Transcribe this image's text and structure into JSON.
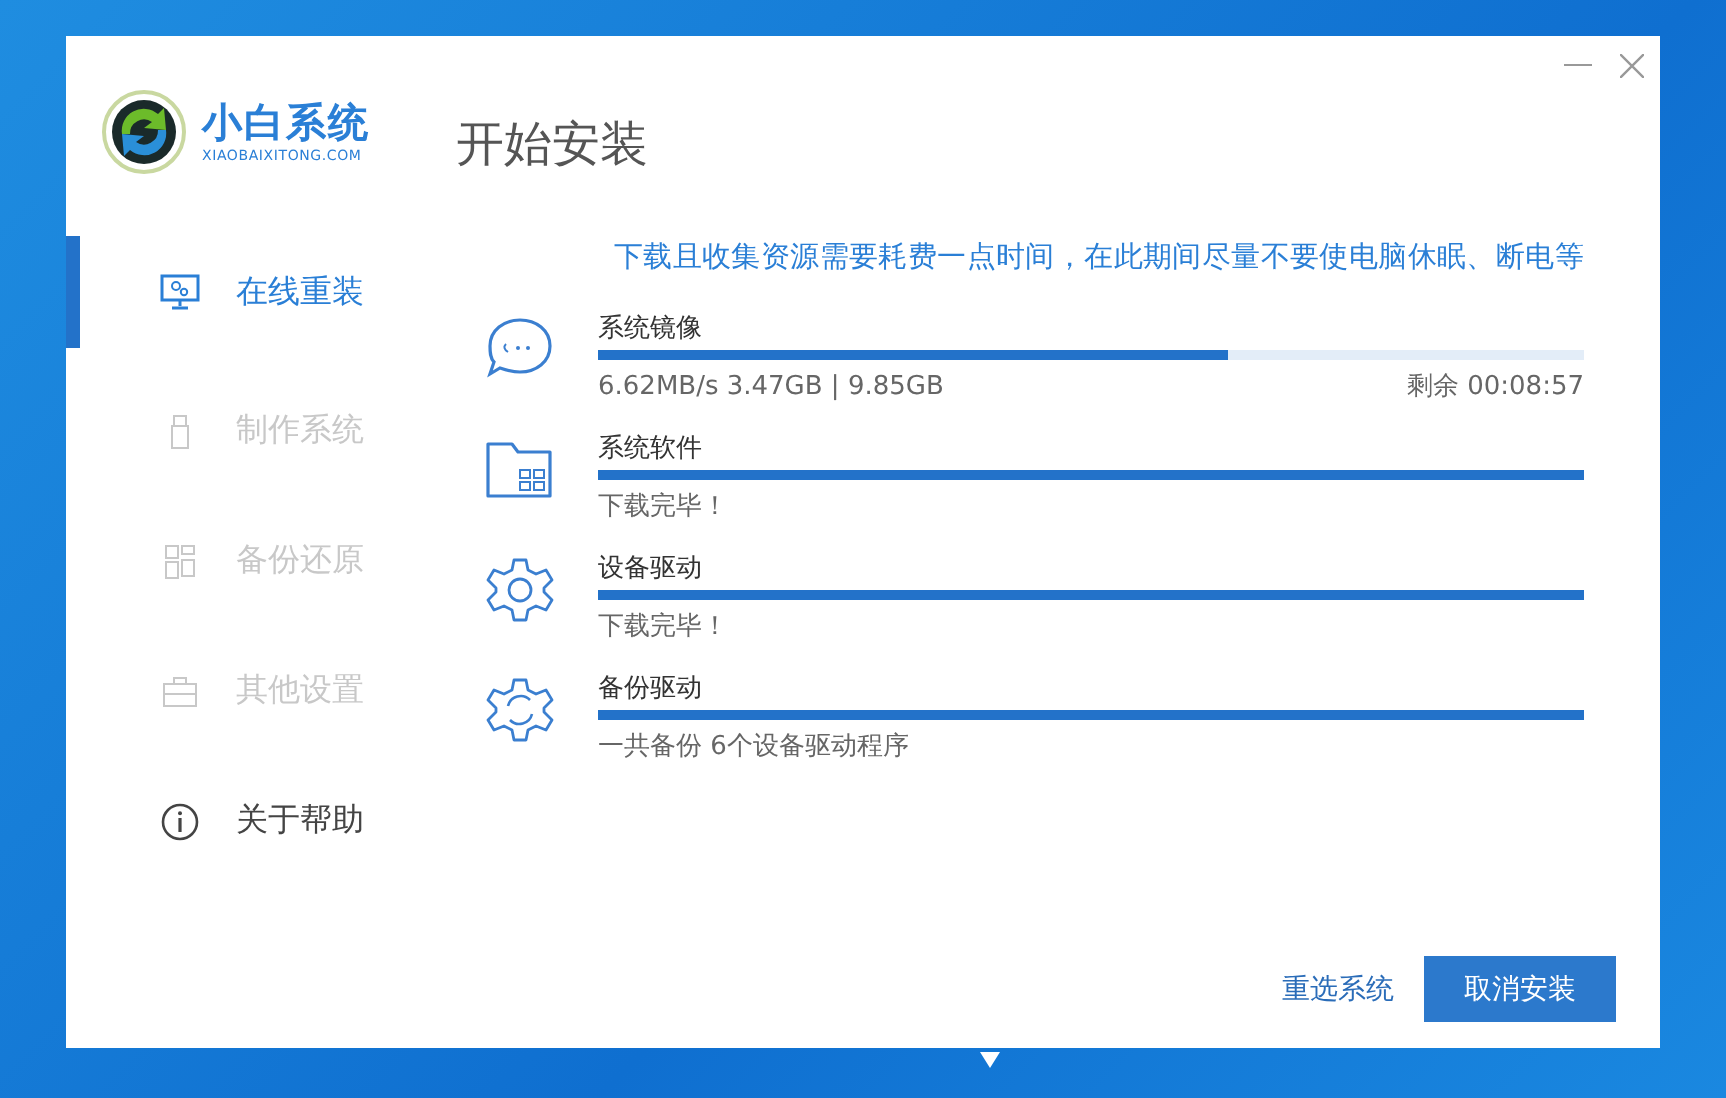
{
  "logo": {
    "name": "小白系统",
    "site": "XIAOBAIXITONG.COM"
  },
  "header": {
    "title": "开始安装"
  },
  "sidebar": {
    "items": [
      {
        "label": "在线重装",
        "selected": true,
        "disabled": false
      },
      {
        "label": "制作系统",
        "selected": false,
        "disabled": true
      },
      {
        "label": "备份还原",
        "selected": false,
        "disabled": true
      },
      {
        "label": "其他设置",
        "selected": false,
        "disabled": true
      },
      {
        "label": "关于帮助",
        "selected": false,
        "disabled": false
      }
    ]
  },
  "notice": "下载且收集资源需要耗费一点时间，在此期间尽量不要使电脑休眠、断电等",
  "downloads": [
    {
      "name": "系统镜像",
      "level": 0.638,
      "speed": "6.62MB/s 3.47GB | 9.85GB",
      "remaining": "剩余 00:08:57"
    },
    {
      "name": "系统软件",
      "level": 1,
      "status": "下载完毕！"
    },
    {
      "name": "设备驱动",
      "level": 1,
      "status": "下载完毕！"
    },
    {
      "name": "备份驱动",
      "level": 1,
      "status": "一共备份 6个设备驱动程序"
    }
  ],
  "buttons": {
    "reselect": "重选系统",
    "cancel": "取消安装"
  }
}
